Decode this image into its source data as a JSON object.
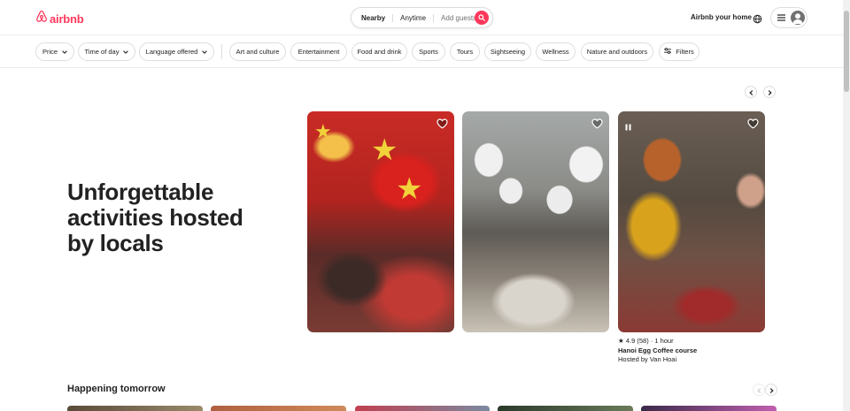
{
  "header": {
    "logo_text": "airbnb",
    "search": {
      "location": "Nearby",
      "dates": "Anytime",
      "guests": "Add guests"
    },
    "host_link": "Airbnb your home",
    "brand_color": "#ff385c"
  },
  "filters": {
    "dropdowns": [
      "Price",
      "Time of day",
      "Language offered"
    ],
    "categories": [
      "Art and culture",
      "Entertainment",
      "Food and drink",
      "Sports",
      "Tours",
      "Sightseeing",
      "Wellness",
      "Nature and outdoors"
    ],
    "filters_label": "Filters"
  },
  "hero": {
    "title": "Unforgettable activities hosted by locals",
    "featured": {
      "rating": "4.9",
      "reviews": "(58)",
      "duration": "1 hour",
      "name": "Hanoi Egg Coffee course",
      "host": "Hosted by Van Hoai"
    }
  },
  "section": {
    "title": "Happening tomorrow"
  },
  "icons": [
    "airbnb-logo-icon",
    "search-icon",
    "globe-icon",
    "menu-icon",
    "user-icon",
    "chevron-down-icon",
    "filters-icon",
    "heart-icon",
    "pause-icon",
    "chevron-left-icon",
    "chevron-right-icon",
    "star-icon"
  ]
}
